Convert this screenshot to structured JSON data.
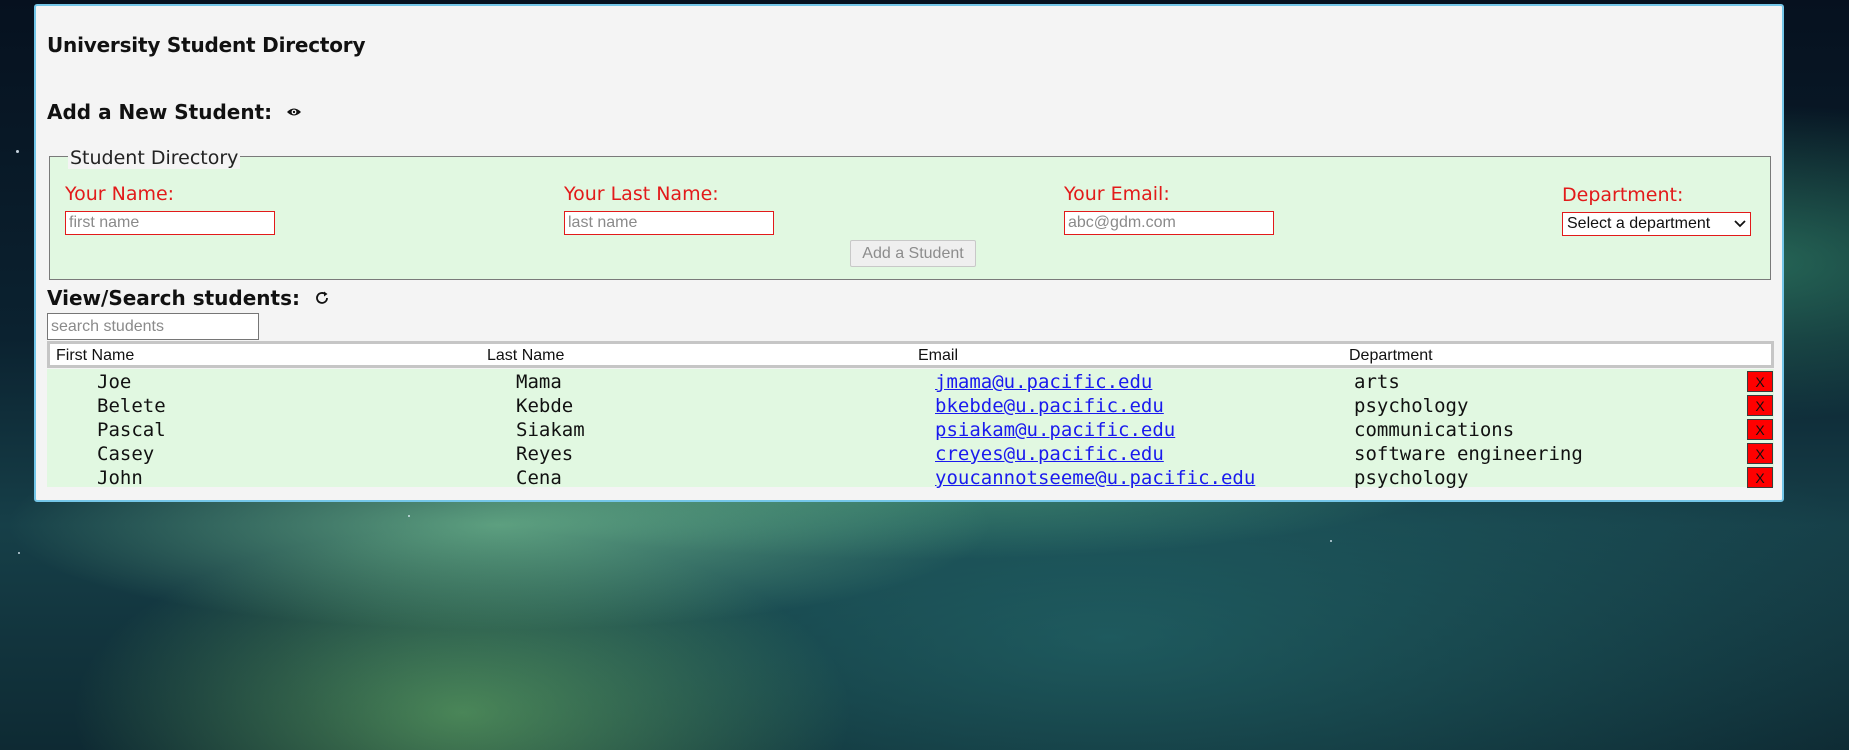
{
  "app": {
    "title": "University Student Directory"
  },
  "add_section": {
    "heading": "Add a New Student:",
    "toggle_icon": "eye-icon"
  },
  "form": {
    "legend": "Student Directory",
    "first_name": {
      "label": "Your Name:",
      "placeholder": "first name",
      "value": ""
    },
    "last_name": {
      "label": "Your Last Name:",
      "placeholder": "last name",
      "value": ""
    },
    "email": {
      "label": "Your Email:",
      "placeholder": "abc@gdm.com",
      "value": ""
    },
    "department": {
      "label": "Department:",
      "selected": "Select a department"
    },
    "submit_label": "Add a Student"
  },
  "view_section": {
    "heading": "View/Search students:",
    "refresh_icon": "refresh-icon",
    "search_placeholder": "search students"
  },
  "table": {
    "columns": [
      "First Name",
      "Last Name",
      "Email",
      "Department"
    ],
    "delete_label": "X",
    "rows": [
      {
        "first": "Joe",
        "last": "Mama",
        "email": "jmama@u.pacific.edu",
        "department": "arts"
      },
      {
        "first": "Belete",
        "last": "Kebde",
        "email": "bkebde@u.pacific.edu",
        "department": "psychology"
      },
      {
        "first": "Pascal",
        "last": "Siakam",
        "email": "psiakam@u.pacific.edu",
        "department": "communications"
      },
      {
        "first": "Casey",
        "last": "Reyes",
        "email": "creyes@u.pacific.edu",
        "department": "software engineering"
      },
      {
        "first": "John",
        "last": "Cena",
        "email": "youcannotseeme@u.pacific.edu",
        "department": "psychology"
      }
    ]
  },
  "colors": {
    "panel_bg": "#f4f4f4",
    "form_bg": "#e1f8e1",
    "label_red": "#e21a1a",
    "delete_red": "#ff0000",
    "panel_border": "#74c6e8"
  }
}
